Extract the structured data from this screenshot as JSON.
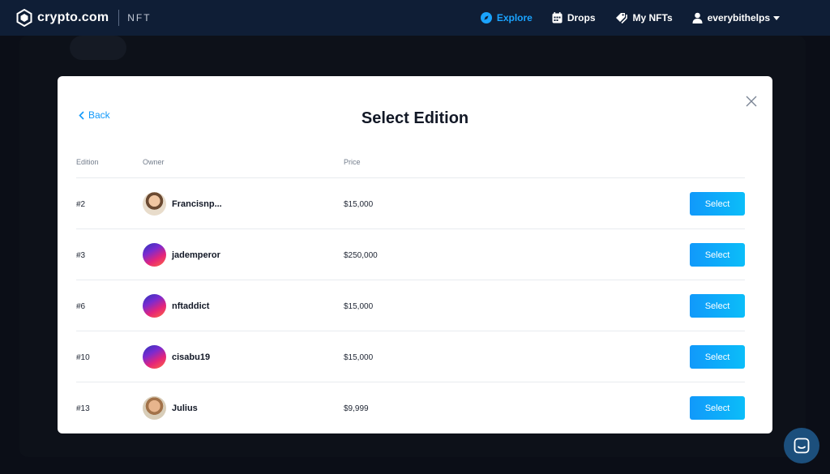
{
  "header": {
    "brand_name": "crypto.com",
    "brand_sub": "NFT",
    "nav": [
      {
        "label": "Explore",
        "icon": "compass-icon",
        "active": true
      },
      {
        "label": "Drops",
        "icon": "calendar-icon",
        "active": false
      },
      {
        "label": "My NFTs",
        "icon": "tags-icon",
        "active": false
      },
      {
        "label": "everybithelps",
        "icon": "user-icon",
        "active": false
      }
    ]
  },
  "modal": {
    "back_label": "Back",
    "title": "Select Edition",
    "columns": {
      "edition": "Edition",
      "owner": "Owner",
      "price": "Price"
    },
    "rows": [
      {
        "edition": "#2",
        "owner": "Francisnp...",
        "price": "$15,000",
        "action": "Select"
      },
      {
        "edition": "#3",
        "owner": "jademperor",
        "price": "$250,000",
        "action": "Select"
      },
      {
        "edition": "#6",
        "owner": "nftaddict",
        "price": "$15,000",
        "action": "Select"
      },
      {
        "edition": "#10",
        "owner": "cisabu19",
        "price": "$15,000",
        "action": "Select"
      },
      {
        "edition": "#13",
        "owner": "Julius",
        "price": "$9,999",
        "action": "Select"
      }
    ]
  },
  "colors": {
    "accent": "#1199fa",
    "topbar": "#0f1e36",
    "chat": "#1c4f7c"
  }
}
